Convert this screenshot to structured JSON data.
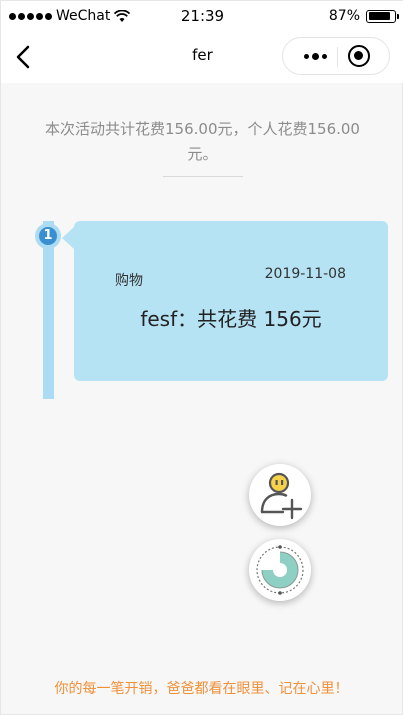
{
  "status_bar": {
    "carrier": "WeChat",
    "time": "21:39",
    "battery": "87%",
    "battery_level": 0.87
  },
  "nav": {
    "title": "fer",
    "back_icon": "chevron-left-icon",
    "more_icon": "more-dots-icon",
    "close_icon": "target-icon"
  },
  "summary": {
    "text": "本次活动共计花费156.00元，个人花费156.00元。"
  },
  "records": [
    {
      "index": "1",
      "category": "购物",
      "date": "2019-11-08",
      "description": "fesf：共花费 156元"
    }
  ],
  "actions": {
    "add_member_icon": "add-user-icon",
    "stats_icon": "pie-chart-icon"
  },
  "footer": {
    "text": "你的每一笔开销，爸爸都看在眼里、记在心里！"
  },
  "colors": {
    "card": "#b5e3f4",
    "timeline": "#abdcf3",
    "badge": "#3a8fd0",
    "footer": "#f0913a"
  }
}
